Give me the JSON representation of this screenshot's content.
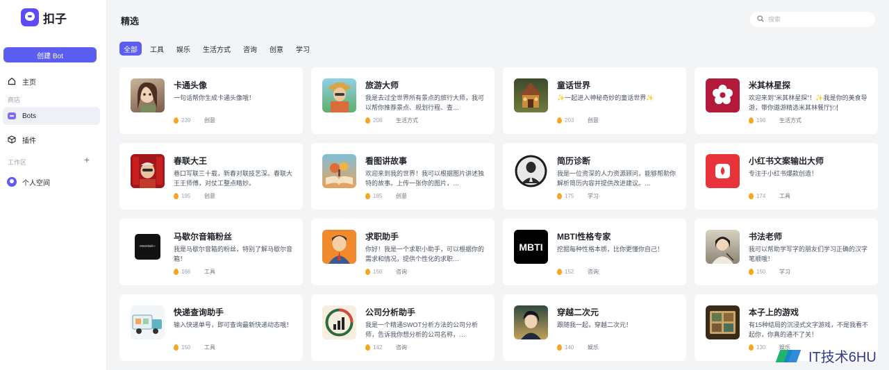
{
  "app": {
    "name": "扣子"
  },
  "sidebar": {
    "create_label": "创建 Bot",
    "home_label": "主页",
    "section_label": "商店",
    "bots_label": "Bots",
    "plugins_label": "插件",
    "workspace_label": "工作区",
    "personal_label": "个人空间"
  },
  "main": {
    "title": "精选",
    "search_placeholder": "搜索",
    "tabs": [
      "全部",
      "工具",
      "娱乐",
      "生活方式",
      "咨询",
      "创意",
      "学习"
    ]
  },
  "cards": [
    {
      "title": "卡通头像",
      "desc": "一句话帮你生成卡通头像哦！",
      "count": "239",
      "category": "创意",
      "thumb": "cartoon-girl"
    },
    {
      "title": "旅游大师",
      "desc": "我是去过全世界所有景点的旅行大师，我可以帮你推荐景点、规划行程、查…",
      "count": "208",
      "category": "生活方式",
      "thumb": "traveler"
    },
    {
      "title": "童话世界",
      "desc": "✨一起进入神秘奇妙的童话世界✨",
      "count": "203",
      "category": "创意",
      "thumb": "fairy-house"
    },
    {
      "title": "米其林星探",
      "desc": "欢迎来到\"米其林星探\"！✨我是你的美食导游，带你遨游精选米其林餐厅🍽",
      "count": "198",
      "category": "生活方式",
      "thumb": "michelin"
    },
    {
      "title": "春联大王",
      "desc": "巷口写联三十载，新春对联技艺深。春联大王王师傅，对仗工整点睛妙。",
      "count": "195",
      "category": "创意",
      "thumb": "couplet-man"
    },
    {
      "title": "看图讲故事",
      "desc": "欢迎来到我的世界！我可以根据图片讲述独特的故事。上传一张你的图片，…",
      "count": "185",
      "category": "创意",
      "thumb": "story-book"
    },
    {
      "title": "简历诊断",
      "desc": "我是一位资深的人力资源顾问，能够帮助你解析简历内容并提供改进建议。…",
      "count": "175",
      "category": "学习",
      "thumb": "resume-man"
    },
    {
      "title": "小红书文案输出大师",
      "desc": "专注于小红书爆款创造！",
      "count": "174",
      "category": "工具",
      "thumb": "red-book"
    },
    {
      "title": "马歇尔音箱粉丝",
      "desc": "我是马歇尔音箱的粉丝，特别了解马歇尔音箱！",
      "count": "166",
      "category": "工具",
      "thumb": "speaker"
    },
    {
      "title": "求职助手",
      "desc": "你好！我是一个求职小助手，可以根据你的需求和情况，提供个性化的求职…",
      "count": "156",
      "category": "咨询",
      "thumb": "job-man"
    },
    {
      "title": "MBTI性格专家",
      "desc": "挖掘每种性格本质，比你更懂你自己！",
      "count": "152",
      "category": "咨询",
      "thumb": "mbti"
    },
    {
      "title": "书法老师",
      "desc": "我可以帮助学写字的朋友们学习正确的汉字笔顺哦！",
      "count": "150",
      "category": "学习",
      "thumb": "calligraphy"
    },
    {
      "title": "快递查询助手",
      "desc": "输入快递单号，即可查询最新快递动态哦！",
      "count": "150",
      "category": "工具",
      "thumb": "delivery-truck"
    },
    {
      "title": "公司分析助手",
      "desc": "我是一个精通SWOT分析方法的公司分析师，告诉我你想分析的公司名称，…",
      "count": "142",
      "category": "咨询",
      "thumb": "company-chart"
    },
    {
      "title": "穿越二次元",
      "desc": "跟随我一起，穿越二次元！",
      "count": "140",
      "category": "娱乐",
      "thumb": "anime"
    },
    {
      "title": "本子上的游戏",
      "desc": "有15种结局的沉浸式文字游戏，不是我看不起你，你真的通不了关！",
      "count": "130",
      "category": "娱乐",
      "thumb": "notebook-game"
    }
  ],
  "watermark": {
    "text": "IT技术6HU"
  },
  "colors": {
    "accent": "#5b5ef0",
    "background": "#f3f4f6",
    "card": "#ffffff"
  }
}
